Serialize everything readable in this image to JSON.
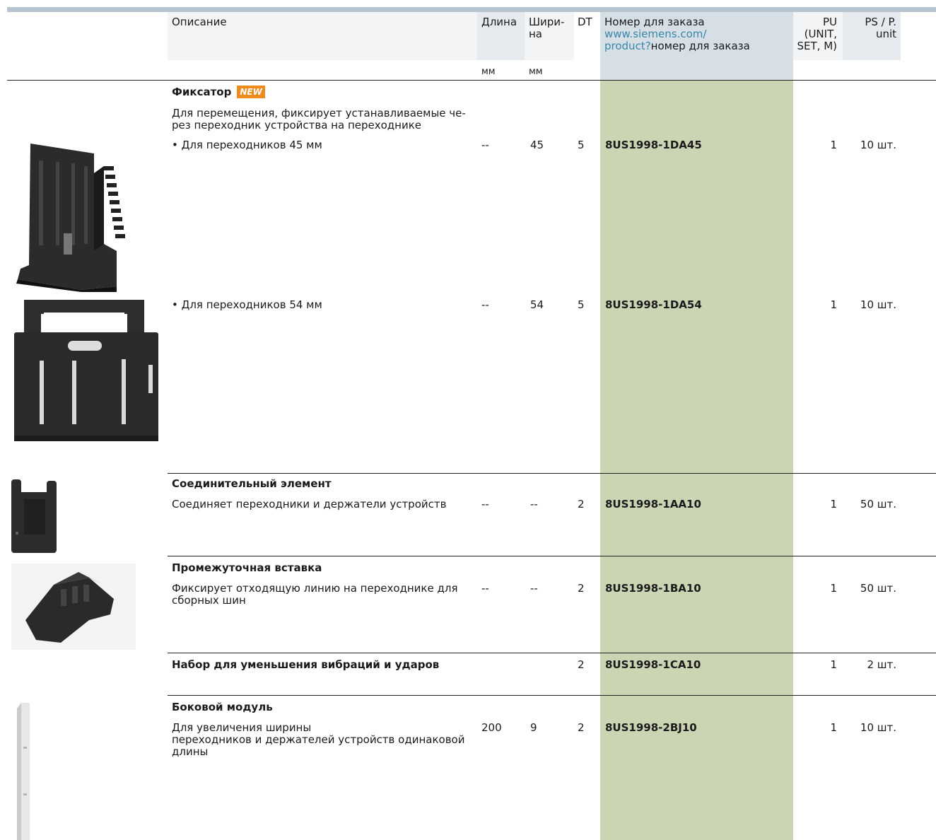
{
  "header": {
    "description": "Описание",
    "length": "Длина",
    "width_line1": "Шири-",
    "width_line2": "на",
    "dt": "DT",
    "order_line1": "Номер для заказа",
    "order_url1": "www.siemens.com/",
    "order_url2": "product?",
    "order_url_suffix": "номер для заказа",
    "pu_line1": "PU",
    "pu_line2": "(UNIT,",
    "pu_line3": "SET, M)",
    "ps_line1": "PS / P.",
    "ps_line2": "unit",
    "unit_length": "мм",
    "unit_width": "мм"
  },
  "sections": {
    "latch": {
      "title": "Фиксатор",
      "badge": "NEW",
      "desc_line1": "Для перемещения, фиксирует устанавливаемые че-",
      "desc_line2": "рез переходник устройства на переходнике",
      "row1": {
        "text": "• Для переходников 45 мм",
        "length": "--",
        "width": "45",
        "dt": "5",
        "order": "8US1998-1DA45",
        "pu": "1",
        "ps": "10 шт."
      },
      "row2": {
        "text": "• Для переходников 54 мм",
        "length": "--",
        "width": "54",
        "dt": "5",
        "order": "8US1998-1DA54",
        "pu": "1",
        "ps": "10 шт."
      }
    },
    "connector": {
      "title": "Соединительный элемент",
      "desc": "Соединяет переходники и держатели устройств",
      "length": "--",
      "width": "--",
      "dt": "2",
      "order": "8US1998-1AA10",
      "pu": "1",
      "ps": "50 шт."
    },
    "spacer": {
      "title": "Промежуточная вставка",
      "desc_line1": "Фиксирует отходящую линию на переходнике для",
      "desc_line2": "сборных шин",
      "length": "--",
      "width": "--",
      "dt": "2",
      "order": "8US1998-1BA10",
      "pu": "1",
      "ps": "50 шт."
    },
    "vibration": {
      "title": "Набор для уменьшения вибраций и ударов",
      "dt": "2",
      "order": "8US1998-1CA10",
      "pu": "1",
      "ps": "2 шт."
    },
    "side": {
      "title": "Боковой модуль",
      "desc_line1": "Для увеличения ширины",
      "desc_line2": "переходников и держателей устройств одинаковой",
      "desc_line3": "длины",
      "length": "200",
      "width": "9",
      "dt": "2",
      "order": "8US1998-2BJ10",
      "pu": "1",
      "ps": "10 шт."
    }
  },
  "colors": {
    "header_bar": "#b5c4d3",
    "order_column": "#cbd5b4",
    "link": "#3a87a8",
    "new_badge": "#ef8a1c"
  }
}
